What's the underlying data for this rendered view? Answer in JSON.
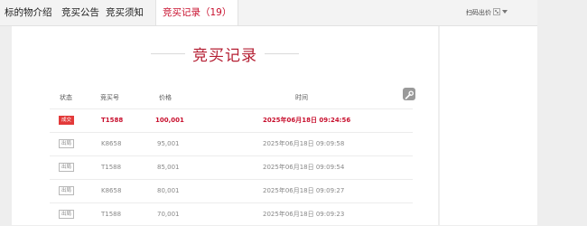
{
  "tabs": [
    {
      "label": "标的物介绍"
    },
    {
      "label": "竞买公告"
    },
    {
      "label": "竞买须知"
    },
    {
      "label": "竞买记录（19）"
    }
  ],
  "scan_bid": {
    "label": "扫码出价",
    "icon": "qr-code-icon"
  },
  "section_title": "竞买记录",
  "table": {
    "columns": [
      "状态",
      "竞买号",
      "价格",
      "时间"
    ],
    "rows": [
      {
        "status": "成交",
        "bidder": "T1588",
        "price": "100,001",
        "time": "2025年06月18日 09:24:56"
      },
      {
        "status": "出局",
        "bidder": "K8658",
        "price": "95,001",
        "time": "2025年06月18日 09:09:58"
      },
      {
        "status": "出局",
        "bidder": "T1588",
        "price": "85,001",
        "time": "2025年06月18日 09:09:54"
      },
      {
        "status": "出局",
        "bidder": "K8658",
        "price": "80,001",
        "time": "2025年06月18日 09:09:27"
      },
      {
        "status": "出局",
        "bidder": "T1588",
        "price": "70,001",
        "time": "2025年06月18日 09:09:23"
      }
    ]
  },
  "colors": {
    "accent": "#c8102e",
    "title": "#b51f33",
    "deal_badge": "#e33a3a"
  }
}
